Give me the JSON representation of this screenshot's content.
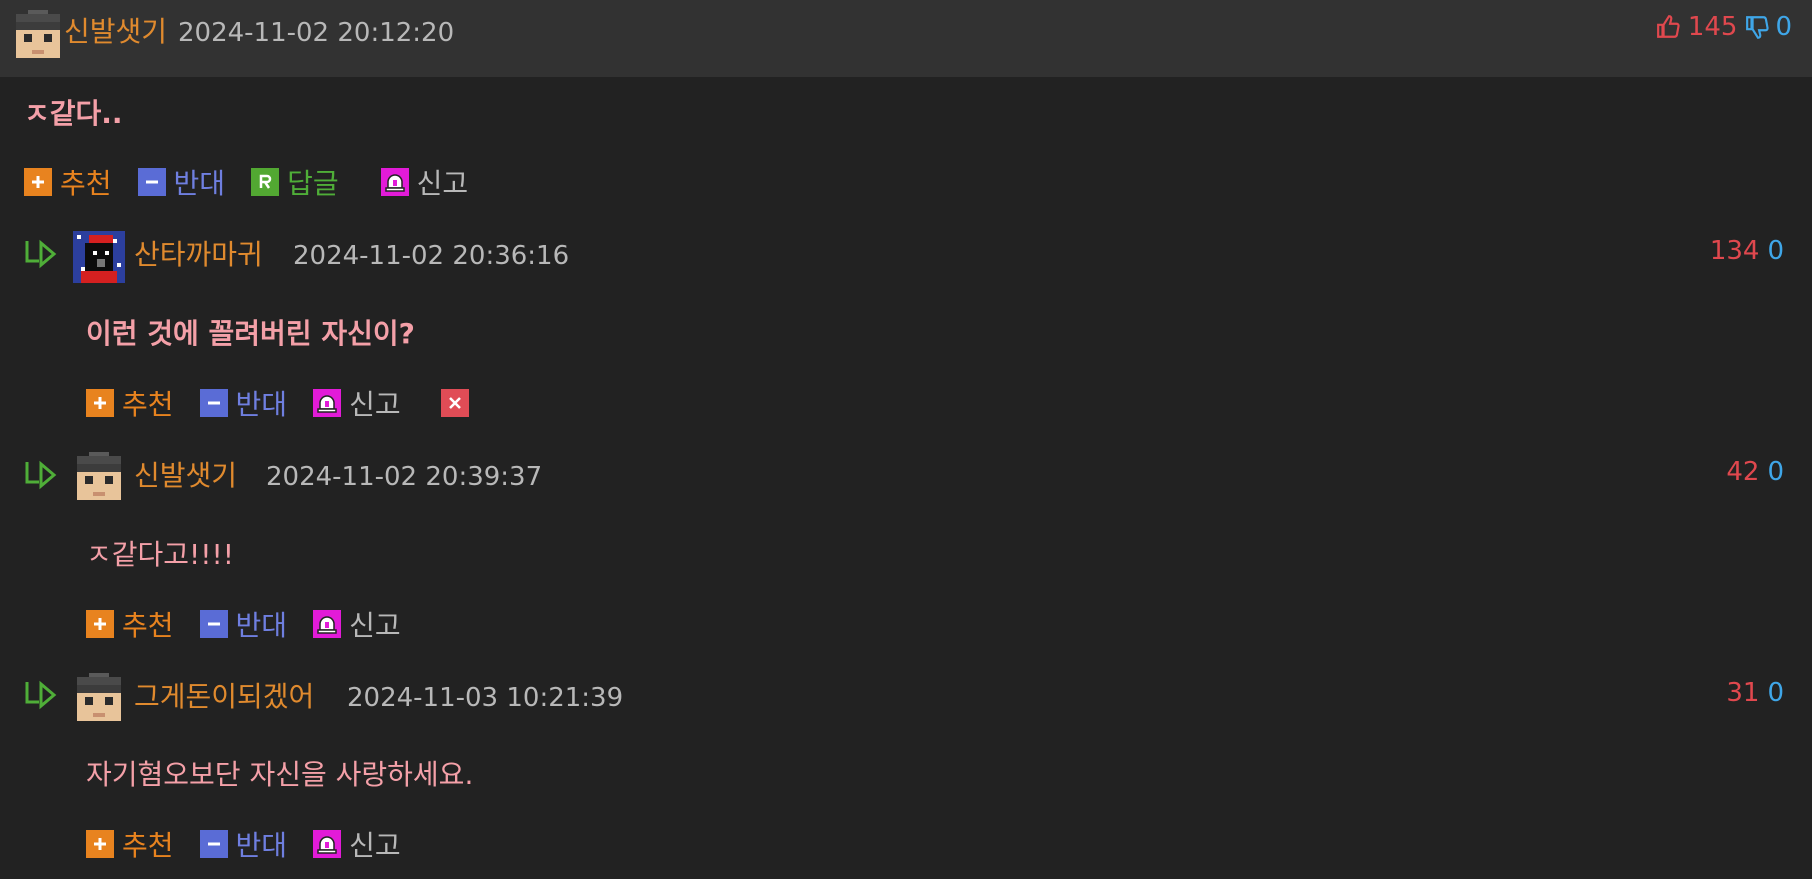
{
  "topbar": {
    "nick": "신발샛기",
    "date": "2024-11-02 20:12:20",
    "up": "145",
    "down": "0"
  },
  "main": {
    "text": "ㅈ같다..",
    "actions": {
      "recommend": "추천",
      "oppose": "반대",
      "reply": "답글",
      "report": "신고"
    }
  },
  "replies": [
    {
      "nick": "산타까마귀",
      "date": "2024-11-02 20:36:16",
      "up": "134",
      "down": "0",
      "text": "이런 것에 꼴려버린 자신이?",
      "actions": {
        "recommend": "추천",
        "oppose": "반대",
        "report": "신고"
      }
    },
    {
      "nick": "신발샛기",
      "date": "2024-11-02 20:39:37",
      "up": "42",
      "down": "0",
      "text": "ㅈ같다고!!!!",
      "actions": {
        "recommend": "추천",
        "oppose": "반대",
        "report": "신고"
      }
    },
    {
      "nick": "그게돈이되겠어",
      "date": "2024-11-03 10:21:39",
      "up": "31",
      "down": "0",
      "text": "자기혐오보단 자신을 사랑하세요.",
      "actions": {
        "recommend": "추천",
        "oppose": "반대",
        "report": "신고"
      }
    }
  ],
  "colors": {
    "background": "#222222",
    "header": "#323232",
    "nickname": "#e08a2e",
    "upvote": "#e0484e",
    "downvote": "#3fa6e8",
    "comment_text": "#f4a0a8"
  },
  "icons": {
    "thumbs_up": "thumbs-up-icon",
    "thumbs_down": "thumbs-down-icon",
    "reply_arrow": "reply-arrow-icon",
    "recommend": "plus-icon",
    "oppose": "minus-icon",
    "reply": "reply-r-icon",
    "report": "siren-icon",
    "delete": "close-icon"
  }
}
